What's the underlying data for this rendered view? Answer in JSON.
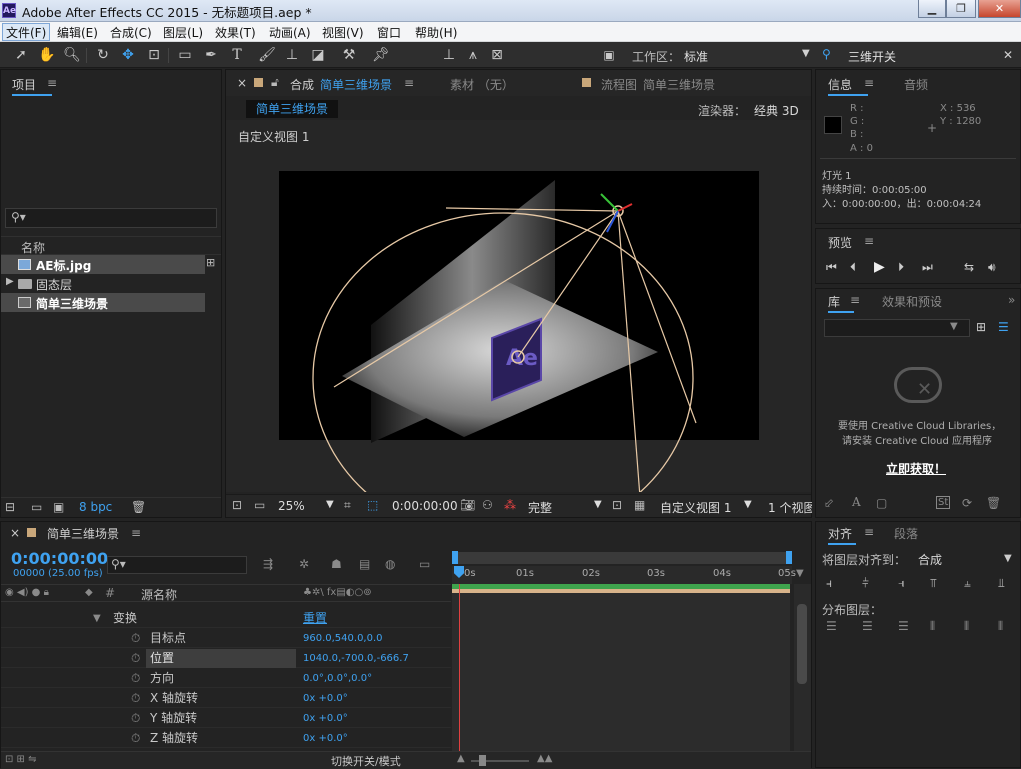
{
  "window": {
    "logo": "Ae",
    "title": "Adobe After Effects CC 2015 - 无标题项目.aep *",
    "min": "▁",
    "max": "❐",
    "close": "✕"
  },
  "menu": [
    "文件(F)",
    "编辑(E)",
    "合成(C)",
    "图层(L)",
    "效果(T)",
    "动画(A)",
    "视图(V)",
    "窗口",
    "帮助(H)"
  ],
  "toolbar": {
    "tools": [
      "selection-tool",
      "hand-tool",
      "zoom-tool",
      "rotate-tool",
      "orbit-camera-tool",
      "pan-behind-tool",
      "rectangle-tool",
      "pen-tool",
      "type-tool",
      "brush-tool",
      "clone-stamp-tool",
      "eraser-tool",
      "roto-brush-tool",
      "puppet-pin-tool",
      "local-axis-icon",
      "world-axis-icon",
      "view-axis-icon"
    ],
    "workspace_label": "工作区：",
    "workspace_value": "标准",
    "search_value": "三维开关"
  },
  "project": {
    "title": "项目",
    "menu": "≡",
    "search_placeholder": "",
    "col_name": "名称",
    "items": [
      {
        "name": "AE标.jpg",
        "type": "image"
      },
      {
        "name": "固态层",
        "type": "folder"
      },
      {
        "name": "简单三维场景",
        "type": "comp"
      }
    ],
    "bpc": "8 bpc"
  },
  "comp_panel": {
    "close": "×",
    "tab_prefix": "合成",
    "tab_comp": "简单三维场景",
    "tab_footage": "素材 （无）",
    "tab_flow_prefix": "流程图",
    "tab_flow": "简单三维场景",
    "breadcrumb": "简单三维场景",
    "renderer_label": "渲染器：",
    "renderer_value": "经典 3D",
    "view_label": "自定义视图 1",
    "footer": {
      "zoom": "25%",
      "timecode": "0:00:00:00",
      "resolution": "完整",
      "view": "自定义视图 1",
      "views": "1 个视图"
    }
  },
  "info": {
    "tab_info": "信息",
    "tab_audio": "音频",
    "r": "R :",
    "g": "G :",
    "b": "B :",
    "a": "A : 0",
    "x": "X : 536",
    "y": "Y : 1280",
    "light": "灯光 1",
    "duration": "持续时间：0:00:05:00",
    "inout": "入：0:00:00:00，出：0:00:04:24"
  },
  "preview": {
    "title": "预览"
  },
  "library": {
    "tab_lib": "库",
    "tab_effects": "效果和预设",
    "msg1": "要使用 Creative Cloud Libraries，",
    "msg2": "请安装 Creative Cloud 应用程序",
    "link": "立即获取！"
  },
  "align": {
    "tab_align": "对齐",
    "tab_para": "段落",
    "align_to_label": "将图层对齐到：",
    "align_to_value": "合成",
    "distribute": "分布图层："
  },
  "timeline": {
    "close": "×",
    "comp_name": "简单三维场景",
    "timecode": "0:00:00:00",
    "frame": "00000 (25.00 fps)",
    "col_num": "#",
    "col_source": "源名称",
    "ruler": [
      "0s",
      "01s",
      "02s",
      "03s",
      "04s",
      "05s"
    ],
    "transform": "变换",
    "reset": "重置",
    "props": [
      {
        "name": "目标点",
        "value": "960.0,540.0,0.0"
      },
      {
        "name": "位置",
        "value": "1040.0,-700.0,-666.7"
      },
      {
        "name": "方向",
        "value": "0.0°,0.0°,0.0°"
      },
      {
        "name": "X 轴旋转",
        "value": "0x +0.0°"
      },
      {
        "name": "Y 轴旋转",
        "value": "0x +0.0°"
      },
      {
        "name": "Z 轴旋转",
        "value": "0x +0.0°"
      }
    ],
    "footer_toggle": "切换开关/模式"
  },
  "colors": {
    "accent": "#3fa2f0",
    "comp_tab": "#3fa2f0",
    "work_area": "#d8b38a",
    "layer_bar": "#3fa44d"
  }
}
